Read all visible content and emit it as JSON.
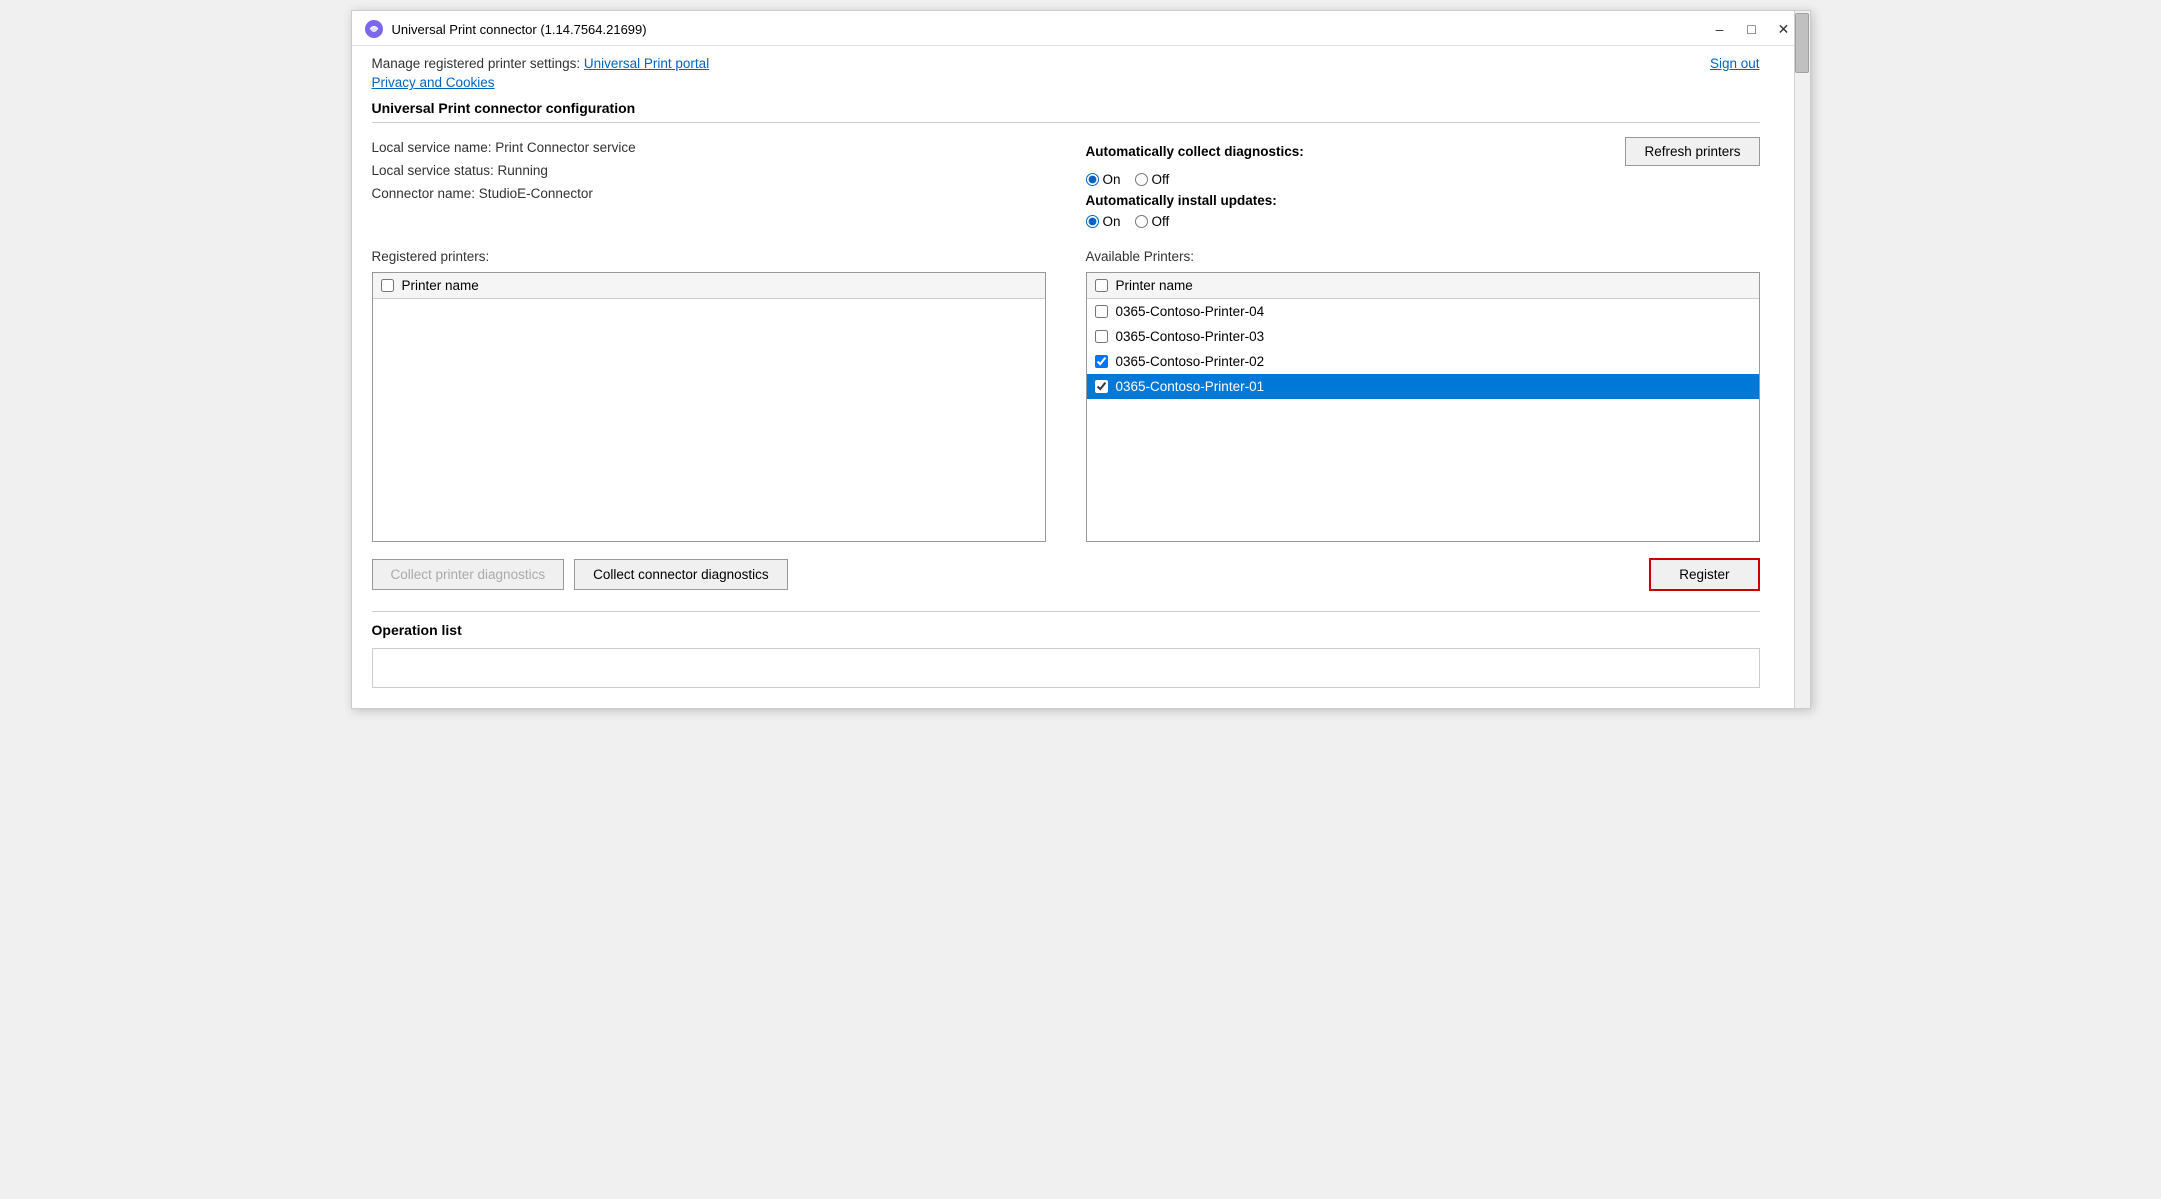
{
  "window": {
    "title": "Universal Print connector (1.14.7564.21699)"
  },
  "header": {
    "manage_text": "Manage registered printer settings:",
    "portal_link": "Universal Print portal",
    "privacy_link": "Privacy and Cookies",
    "sign_out": "Sign out"
  },
  "config_section": {
    "title": "Universal Print connector configuration",
    "service_name": "Local service name: Print Connector service",
    "service_status": "Local service status: Running",
    "connector_name": "Connector name: StudioE-Connector"
  },
  "diagnostics": {
    "auto_collect_label": "Automatically collect diagnostics:",
    "auto_collect_on": "On",
    "auto_collect_off": "Off",
    "auto_install_label": "Automatically install updates:",
    "auto_install_on": "On",
    "auto_install_off": "Off"
  },
  "refresh_btn": "Refresh printers",
  "registered_printers": {
    "label": "Registered printers:",
    "header": "Printer name",
    "items": []
  },
  "available_printers": {
    "label": "Available Printers:",
    "header": "Printer name",
    "items": [
      {
        "name": "0365-Contoso-Printer-04",
        "checked": false,
        "selected": false
      },
      {
        "name": "0365-Contoso-Printer-03",
        "checked": false,
        "selected": false
      },
      {
        "name": "0365-Contoso-Printer-02",
        "checked": true,
        "selected": false
      },
      {
        "name": "0365-Contoso-Printer-01",
        "checked": true,
        "selected": true
      }
    ]
  },
  "buttons": {
    "collect_printer_diag": "Collect printer diagnostics",
    "collect_connector_diag": "Collect connector diagnostics",
    "register": "Register"
  },
  "operation_list": {
    "title": "Operation list"
  }
}
